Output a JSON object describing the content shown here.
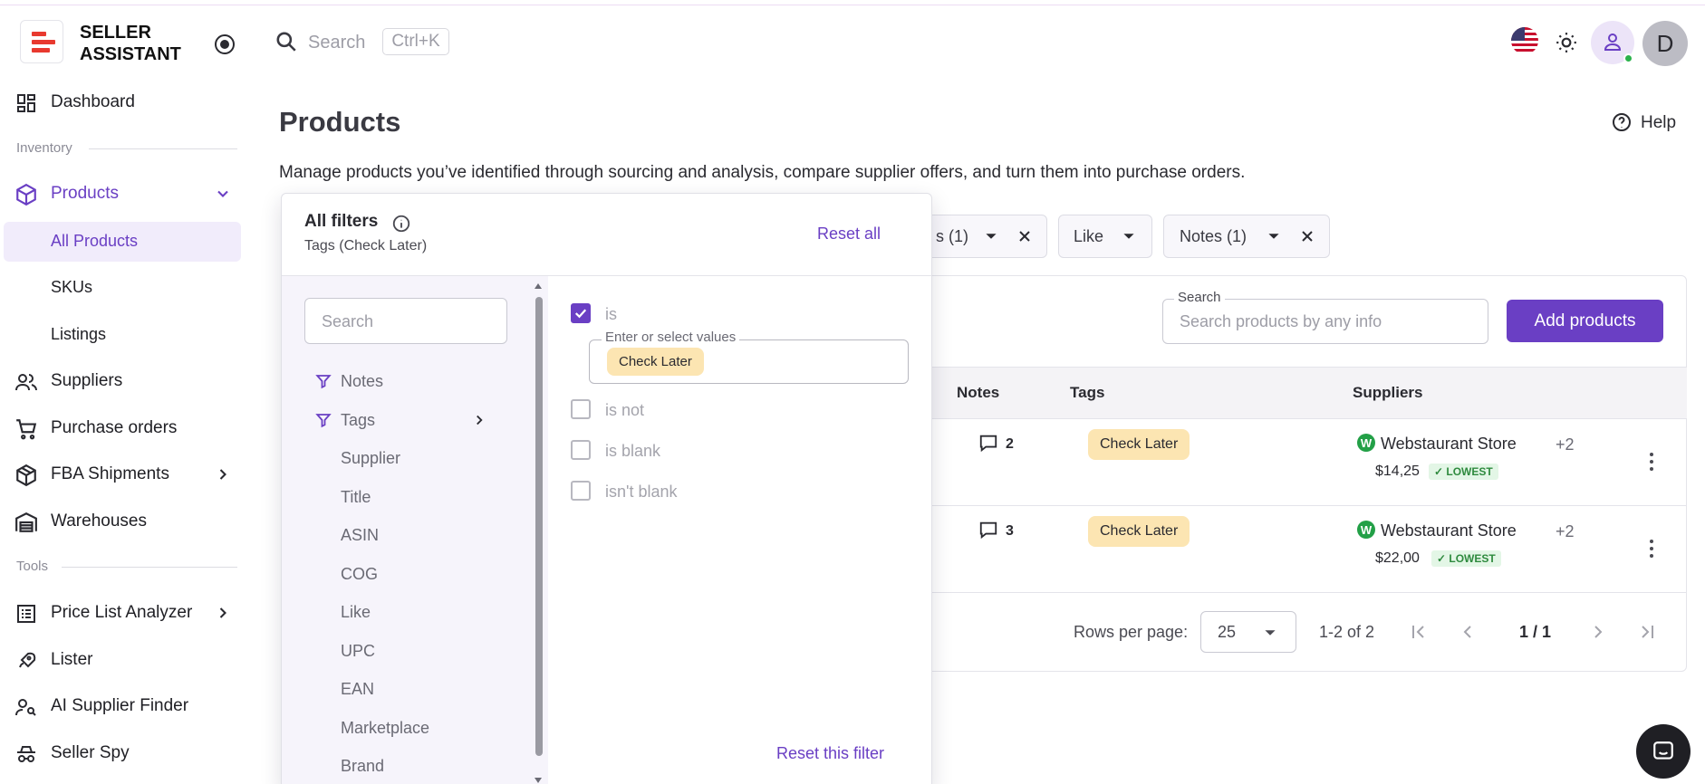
{
  "brand": {
    "line1": "SELLER",
    "line2": "ASSISTANT"
  },
  "header": {
    "search_placeholder": "Search",
    "shortcut": "Ctrl+K",
    "avatar_letter": "D"
  },
  "sidebar": {
    "dashboard": "Dashboard",
    "section_inventory": "Inventory",
    "products": "Products",
    "sub": [
      "All Products",
      "SKUs",
      "Listings"
    ],
    "suppliers": "Suppliers",
    "purchase_orders": "Purchase orders",
    "fba_shipments": "FBA Shipments",
    "warehouses": "Warehouses",
    "section_tools": "Tools",
    "price_list_analyzer": "Price List Analyzer",
    "lister": "Lister",
    "ai_supplier_finder": "AI Supplier Finder",
    "seller_spy": "Seller Spy"
  },
  "page": {
    "title": "Products",
    "help": "Help",
    "description": "Manage products you’ve identified through sourcing and analysis, compare supplier offers, and turn them into purchase orders."
  },
  "chips": {
    "tags_partial": "s (1)",
    "like": "Like",
    "notes": "Notes (1)"
  },
  "toolbar": {
    "search_legend": "Search",
    "search_placeholder": "Search products by any info",
    "add_button": "Add products"
  },
  "table": {
    "headers": {
      "notes": "Notes",
      "tags": "Tags",
      "suppliers": "Suppliers"
    },
    "rows": [
      {
        "notes": "2",
        "tag": "Check Later",
        "supplier": "Webstaurant Store",
        "more": "+2",
        "price": "$14,25",
        "badge": "✓ LOWEST"
      },
      {
        "notes": "3",
        "tag": "Check Later",
        "supplier": "Webstaurant Store",
        "more": "+2",
        "price": "$22,00",
        "badge": "✓ LOWEST"
      }
    ]
  },
  "pagination": {
    "rows_per_page_label": "Rows per page:",
    "rows_per_page": "25",
    "range": "1-2 of 2",
    "page": "1 / 1"
  },
  "filters": {
    "title": "All filters",
    "subtitle": "Tags (Check Later)",
    "reset_all": "Reset all",
    "search_placeholder": "Search",
    "fields": [
      "Notes",
      "Tags",
      "Supplier",
      "Title",
      "ASIN",
      "COG",
      "Like",
      "UPC",
      "EAN",
      "Marketplace",
      "Brand"
    ],
    "options": {
      "is": "is",
      "is_not": "is not",
      "is_blank": "is blank",
      "isnt_blank": "isn't blank"
    },
    "values_label": "Enter or select values",
    "selected_value": "Check Later",
    "reset_filter": "Reset this filter"
  },
  "colors": {
    "accent": "#6a3fc4",
    "tag_bg": "#fce5b2",
    "lowest_bg": "#e3f6e6",
    "logo_red": "#e8392f"
  }
}
